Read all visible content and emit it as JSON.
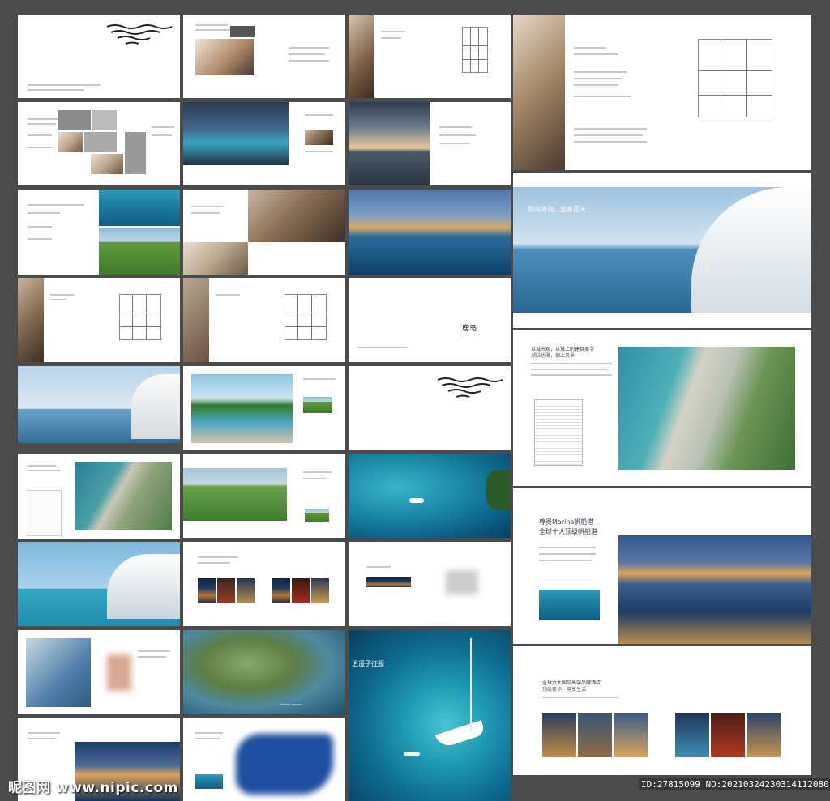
{
  "brand": {
    "logo_text": "鹿岛"
  },
  "headings": {
    "blue_sea": "踏浪听海，坐享蓝天",
    "marina_title": "尊贵Marina帆船港",
    "marina_sub": "全球十大顶级帆船港",
    "hotels_title": "全球六大国际高端品牌酒店",
    "hotels_sub": "顶级奢华，尊享生活",
    "city_title": "以城市观，以城上的建筑美学",
    "city_sub": "湖陆优雅，栖上风景",
    "yacht_caption": "逍遥子征服",
    "yacht_small": "逍遥子征服"
  },
  "footer": {
    "watermark": "昵图网 www.nipic.com",
    "id_text": "ID:27815099 NO:20210324230314112080"
  },
  "colors": {
    "board": "#4b4b4b",
    "page": "#ffffff",
    "sea": "#1f7fa3"
  }
}
